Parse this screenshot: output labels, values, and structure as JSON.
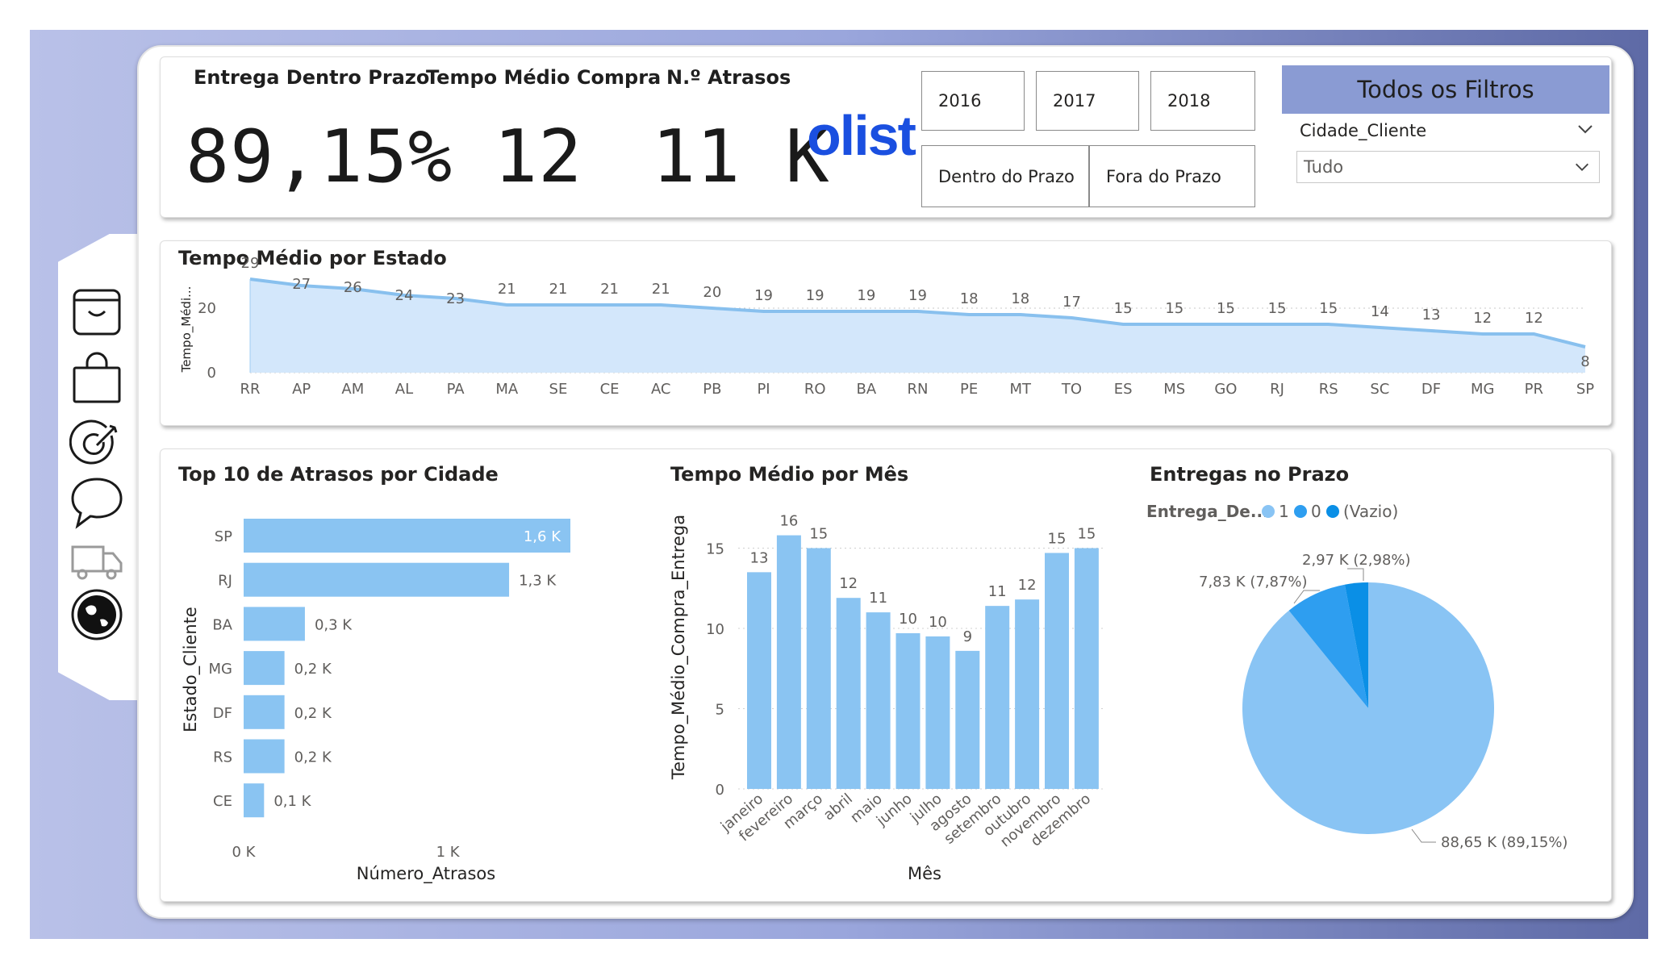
{
  "kpis": [
    {
      "label": "Entrega Dentro Prazo",
      "value": "89,15%"
    },
    {
      "label": "Tempo Médio Compra",
      "value": "12"
    },
    {
      "label": "N.º Atrasos",
      "value": "11 K"
    }
  ],
  "brand": {
    "logo_text": "olist",
    "color": "#1a4fe0"
  },
  "year_slicer": [
    "2016",
    "2017",
    "2018"
  ],
  "prazo_slicer": [
    "Dentro do Prazo",
    "Fora do Prazo"
  ],
  "filters": {
    "header": "Todos os Filtros",
    "field_label": "Cidade_Cliente",
    "selected": "Tudo"
  },
  "nav": {
    "icons": [
      "store-icon",
      "shopping-bag-icon",
      "target-icon",
      "chat-icon",
      "truck-icon",
      "globe-icon"
    ]
  },
  "colors": {
    "bar": "#8ac4f2",
    "area_fill": "#d3e7fb",
    "line": "#88c0ee",
    "pie_1": "#89c4f4",
    "pie_0": "#2e9ef0",
    "pie_vazio": "#0a8fe6",
    "filter_header": "#8a9bd3"
  },
  "chart_data": [
    {
      "type": "area",
      "title": "Tempo Médio por Estado",
      "ylabel": "Tempo_Médi...",
      "categories": [
        "RR",
        "AP",
        "AM",
        "AL",
        "PA",
        "MA",
        "SE",
        "CE",
        "AC",
        "PB",
        "PI",
        "RO",
        "BA",
        "RN",
        "PE",
        "MT",
        "TO",
        "ES",
        "MS",
        "GO",
        "RJ",
        "RS",
        "SC",
        "DF",
        "MG",
        "PR",
        "SP"
      ],
      "values": [
        29,
        27,
        26,
        24,
        23,
        21,
        21,
        21,
        21,
        20,
        19,
        19,
        19,
        19,
        18,
        18,
        17,
        15,
        15,
        15,
        15,
        15,
        14,
        13,
        12,
        12,
        8
      ],
      "ylim": [
        0,
        30
      ],
      "yticks": [
        "0",
        "20"
      ],
      "grid": true
    },
    {
      "type": "bar",
      "orientation": "horizontal",
      "title": "Top 10 de Atrasos por Cidade",
      "ylabel": "Estado_Cliente",
      "xlabel": "Número_Atrasos",
      "categories": [
        "SP",
        "RJ",
        "BA",
        "MG",
        "DF",
        "RS",
        "CE"
      ],
      "values": [
        1.6,
        1.3,
        0.3,
        0.2,
        0.2,
        0.2,
        0.1
      ],
      "data_labels": [
        "1,6 K",
        "1,3 K",
        "0,3 K",
        "0,2 K",
        "0,2 K",
        "0,2 K",
        "0,1 K"
      ],
      "xticks": [
        "0 K",
        "1 K"
      ],
      "xlim": [
        0,
        1.6
      ]
    },
    {
      "type": "bar",
      "title": "Tempo Médio por Mês",
      "ylabel": "Tempo_Médio_Compra_Entrega",
      "xlabel": "Mês",
      "categories": [
        "janeiro",
        "fevereiro",
        "março",
        "abril",
        "maio",
        "junho",
        "julho",
        "agosto",
        "setembro",
        "outubro",
        "novembro",
        "dezembro"
      ],
      "values": [
        13.5,
        15.8,
        15,
        11.9,
        11,
        9.7,
        9.5,
        8.6,
        11.4,
        11.8,
        14.7,
        15
      ],
      "data_labels": [
        "13",
        "16",
        "15",
        "12",
        "11",
        "10",
        "10",
        "9",
        "11",
        "12",
        "15",
        "15"
      ],
      "yticks": [
        "0",
        "5",
        "10",
        "15"
      ],
      "ylim": [
        0,
        17
      ],
      "grid": true
    },
    {
      "type": "pie",
      "title": "Entregas no Prazo",
      "legend_title": "Entrega_De...",
      "legend_position": "top-left",
      "slices": [
        {
          "name": "1",
          "value": 88.65,
          "label": "88,65 K (89,15%)"
        },
        {
          "name": "0",
          "value": 7.83,
          "label": "7,83 K (7,87%)"
        },
        {
          "name": "(Vazio)",
          "value": 2.97,
          "label": "2,97 K (2,98%)"
        }
      ]
    }
  ]
}
